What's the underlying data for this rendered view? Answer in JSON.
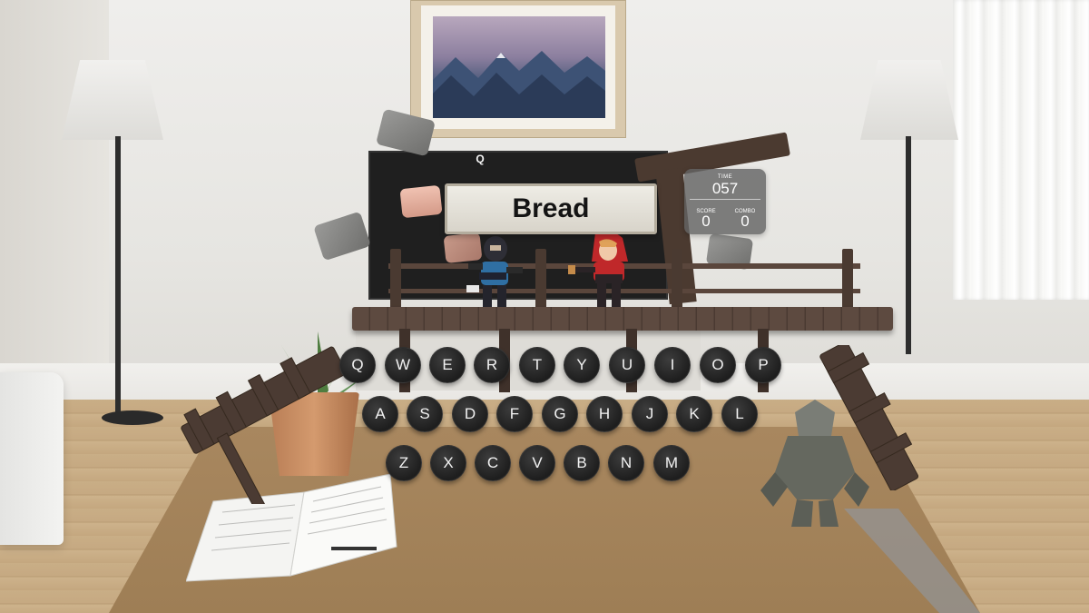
{
  "game": {
    "target_word": "Bread",
    "hint_letter": "Q",
    "hud": {
      "time_label": "TIME",
      "time_value": "057",
      "score_label": "SCORE",
      "score_value": "0",
      "combo_label": "COMBO",
      "combo_value": "0"
    }
  },
  "keyboard": {
    "row1": [
      "Q",
      "W",
      "E",
      "R",
      "T",
      "Y",
      "U",
      "I",
      "O",
      "P"
    ],
    "row2": [
      "A",
      "S",
      "D",
      "F",
      "G",
      "H",
      "J",
      "K",
      "L"
    ],
    "row3": [
      "Z",
      "X",
      "C",
      "V",
      "B",
      "N",
      "M"
    ]
  },
  "colors": {
    "key_bg": "#242424",
    "key_text": "#f2f2f2",
    "hud_bg": "#646464",
    "sign_bg": "#e6e3db",
    "bridge_wood": "#5d4a40"
  }
}
